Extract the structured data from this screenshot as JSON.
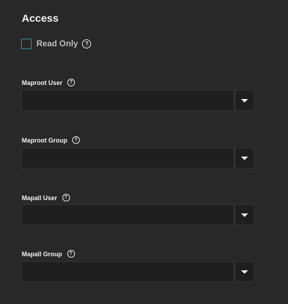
{
  "section": {
    "title": "Access"
  },
  "read_only": {
    "label": "Read Only",
    "checked": false,
    "help_icon": "help-circle-icon"
  },
  "fields": [
    {
      "label": "Maproot User",
      "value": "",
      "help_icon": "help-circle-icon"
    },
    {
      "label": "Maproot Group",
      "value": "",
      "help_icon": "help-circle-icon"
    },
    {
      "label": "Mapall User",
      "value": "",
      "help_icon": "help-circle-icon"
    },
    {
      "label": "Mapall Group",
      "value": "",
      "help_icon": "help-circle-icon"
    }
  ],
  "colors": {
    "background": "#282828",
    "input_background": "#1f1f1f",
    "checkbox_border": "#2f8fb0",
    "text": "#f0f0f0"
  }
}
